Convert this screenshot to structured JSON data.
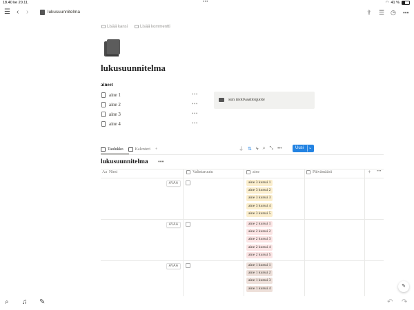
{
  "status_bar": {
    "time": "18.40",
    "date": "ke 20.11.",
    "dots": "•••",
    "battery_text": "41 %",
    "battery_level": 0.41
  },
  "top_bar": {
    "doc_title": "lukusuunnitelma",
    "menu_icon": "hamburger-icon",
    "back_icon": "chevron-left-icon",
    "forward_icon": "chevron-right-icon",
    "share_icon": "share-icon",
    "comments_icon": "comments-icon",
    "updates_icon": "clock-icon",
    "more": "•••"
  },
  "page": {
    "add_cover": "Lisää kansi",
    "add_comment": "Lisää kommentti",
    "title": "lukusuunnitelma",
    "aineet_heading": "aineet",
    "aineet": [
      {
        "label": "aine 1",
        "more": "•••"
      },
      {
        "label": "aine 2",
        "more": "•••"
      },
      {
        "label": "aine 3",
        "more": "•••"
      },
      {
        "label": "aine 4",
        "more": "•••"
      }
    ],
    "quote": "sun motivaatioquote"
  },
  "database": {
    "tabs": [
      {
        "label": "Taulukko",
        "active": true
      },
      {
        "label": "Kalenteri",
        "active": false
      }
    ],
    "add_view": "+",
    "tools_more": "•••",
    "new_button": "Uusi",
    "new_chevron": "⌄",
    "title": "lukusuunnitelma",
    "title_more": "•••",
    "columns": [
      "Nimi",
      "Valintaruutu",
      "aine",
      "Päivämäärä"
    ],
    "add_column": "+",
    "columns_more": "•••",
    "open_label": "AVAA",
    "rows": [
      {
        "tags": [
          "aine 3 kurssi 1",
          "aine 3 kurssi 2",
          "aine 3 kurssi 3",
          "aine 3 kurssi 4",
          "aine 3 kurssi 5"
        ],
        "tag_color": "#fbeecd"
      },
      {
        "tags": [
          "aine 2 kurssi 1",
          "aine 2 kurssi 2",
          "aine 2 kurssi 3",
          "aine 2 kurssi 4",
          "aine 2 kurssi 5"
        ],
        "tag_color": "#fbe4e4"
      },
      {
        "tags": [
          "aine 1 kurssi 1",
          "aine 1 kurssi 2",
          "aine 1 kurssi 3",
          "aine 1 kurssi 4"
        ],
        "tag_color": "#eee0da"
      }
    ]
  },
  "bottom_bar": {
    "search_icon": "search-icon",
    "bell_icon": "bell-icon",
    "compose_icon": "compose-icon",
    "undo_icon": "undo-icon",
    "redo_icon": "redo-icon",
    "fab_icon": "sparkle-icon"
  }
}
